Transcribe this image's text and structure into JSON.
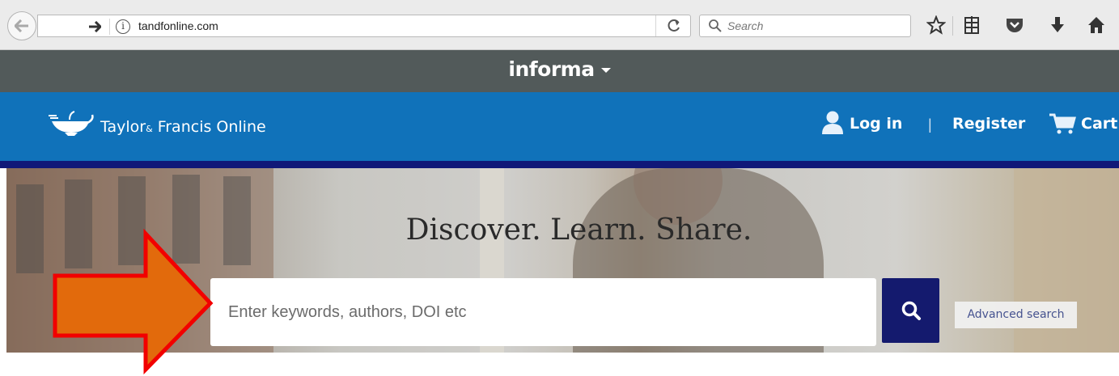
{
  "browser": {
    "url": "tandfonline.com",
    "search_placeholder": "Search",
    "info_glyph": "i",
    "reload_glyph": "C",
    "icons": [
      "back-arrow-icon",
      "forward-arrow-icon",
      "info-icon",
      "reload-icon",
      "search-icon",
      "star-icon",
      "reading-list-icon",
      "pocket-icon",
      "download-icon",
      "home-icon"
    ]
  },
  "informa_bar": {
    "label": "informa"
  },
  "header": {
    "logo_main": "Taylor",
    "logo_amp": "&",
    "logo_rest": "Francis Online",
    "login": "Log in",
    "divider": "|",
    "register": "Register",
    "cart": "Cart",
    "colors": {
      "header_bg": "#1072ba",
      "header_border": "#101878",
      "informa_bg": "#525a5a"
    }
  },
  "hero": {
    "title": "Discover. Learn. Share.",
    "search_placeholder": "Enter keywords, authors, DOI etc",
    "advanced_search": "Advanced search",
    "colors": {
      "search_button": "#141a6e"
    }
  },
  "annotation": {
    "type": "arrow",
    "fill": "#e26a0c",
    "stroke": "#f20000",
    "direction": "right"
  }
}
